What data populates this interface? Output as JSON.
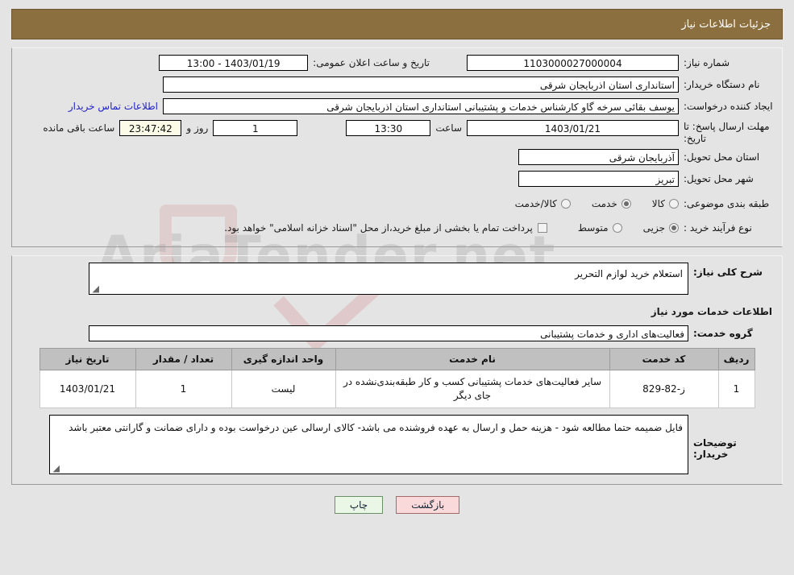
{
  "header": {
    "title": "جزئیات اطلاعات نیاز"
  },
  "info": {
    "need_number_label": "شماره نیاز:",
    "need_number_value": "1103000027000004",
    "announce_label": "تاریخ و ساعت اعلان عمومی:",
    "announce_value": "1403/01/19 - 13:00",
    "buyer_org_label": "نام دستگاه خریدار:",
    "buyer_org_value": "استانداری استان اذربایجان شرقی",
    "requester_label": "ایجاد کننده درخواست:",
    "requester_value": "یوسف بقائی سرخه گاو کارشناس خدمات و پشتیبانی استانداری استان اذربایجان شرقی",
    "contact_link": "اطلاعات تماس خریدار",
    "deadline_label": "مهلت ارسال پاسخ: تا تاریخ:",
    "deadline_date": "1403/01/21",
    "hour_label": "ساعت",
    "deadline_time": "13:30",
    "days_value": "1",
    "days_label": "روز و",
    "countdown_value": "23:47:42",
    "remaining_label": "ساعت باقی مانده",
    "province_label": "استان محل تحویل:",
    "province_value": "آذربایجان شرقی",
    "city_label": "شهر محل تحویل:",
    "city_value": "تبریز",
    "category_label": "طبقه بندی موضوعی:",
    "category_options": [
      {
        "label": "کالا",
        "selected": false
      },
      {
        "label": "خدمت",
        "selected": true
      },
      {
        "label": "کالا/خدمت",
        "selected": false
      }
    ],
    "process_label": "نوع فرآیند خرید :",
    "process_options": [
      {
        "label": "جزیی",
        "selected": true
      },
      {
        "label": "متوسط",
        "selected": false
      }
    ],
    "treasury_checkbox_checked": false,
    "treasury_text": "پرداخت تمام یا بخشی از مبلغ خرید،از محل \"اسناد خزانه اسلامی\" خواهد بود."
  },
  "detail": {
    "general_desc_label": "شرح کلی نیاز:",
    "general_desc_value": "استعلام خرید لوازم التحریر",
    "services_title": "اطلاعات خدمات مورد نیاز",
    "service_group_label": "گروه خدمت:",
    "service_group_value": "فعالیت‌های اداری و خدمات پشتیبانی",
    "table": {
      "columns": [
        "ردیف",
        "کد خدمت",
        "نام خدمت",
        "واحد اندازه گیری",
        "تعداد / مقدار",
        "تاریخ نیاز"
      ],
      "rows": [
        {
          "row": "1",
          "code": "ز-82-829",
          "name": "سایر فعالیت‌های خدمات پشتیبانی کسب و کار طبقه‌بندی‌نشده در جای دیگر",
          "unit": "لیست",
          "qty": "1",
          "date": "1403/01/21"
        }
      ]
    },
    "buyer_notes_label": "توضیحات خریدار:",
    "buyer_notes_value": "فایل ضمیمه حتما مطالعه شود - هزینه حمل و ارسال به عهده فروشنده می باشد- کالای ارسالی عین درخواست بوده و دارای ضمانت و گارانتی معتبر باشد"
  },
  "footer": {
    "print_label": "چاپ",
    "back_label": "بازگشت"
  },
  "watermark": {
    "text": "AriaTender.net"
  },
  "colors": {
    "header_bar": "#8c6f3f",
    "table_header": "#c0c0c0",
    "link": "#2222cc",
    "print_button": "#eaf7e7",
    "back_button": "#f9d9d9",
    "countdown_field": "#fbfbe8"
  }
}
